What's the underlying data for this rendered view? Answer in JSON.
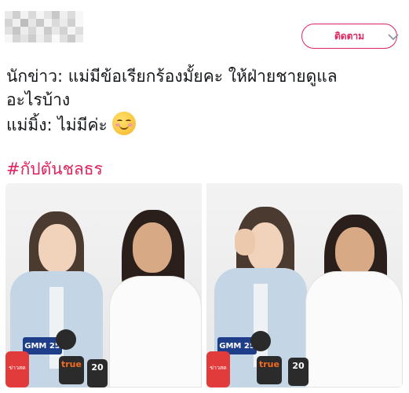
{
  "header": {
    "follow_label": "ติดตาม",
    "avatar_pixels": [
      "#e9e9e9",
      "#cfcfcf",
      "#f2f2f2",
      "#d9d9d9",
      "#f5f5f5",
      "#e4e4e4",
      "#c8c8c8",
      "#efefef",
      "#dcdcdc",
      "#f7f7f7",
      "#d4d4d4",
      "#f0f0f0",
      "#bdbdbd",
      "#e6e6e6",
      "#c9c9c9",
      "#f3f3f3",
      "#dadada",
      "#ebebeb",
      "#d0d0d0",
      "#f8f8f8",
      "#e1e1e1",
      "#c6c6c6",
      "#ededed",
      "#d7d7d7",
      "#f1f1f1",
      "#cbcbcb",
      "#e8e8e8",
      "#d2d2d2",
      "#f4f4f4",
      "#dedede",
      "#f6f6f6",
      "#d5d5d5",
      "#e3e3e3",
      "#cdcdcd",
      "#eeeeee",
      "#d8d8d8",
      "#f9f9f9",
      "#e0e0e0",
      "#cacaca",
      "#ececec"
    ]
  },
  "tweet": {
    "line1": "นักข่าว: แม่มีข้อเรียกร้องมั้ยคะ ให้ฝ่ายชายดูแล",
    "line2": "อะไรบ้าง",
    "line3": "แม่มิ้ง:  ไม่มีค่ะ",
    "emoji": "smiling-face-with-smiling-eyes",
    "hashtag": "#กัปตันชลธร"
  },
  "media": {
    "photo1": {
      "board_label": "GMM 25",
      "mic_brand": "true",
      "mic_channel": "20",
      "mic_red_label": "ข่าวสด"
    },
    "photo2": {
      "board_label": "GMM 25",
      "mic_brand": "true",
      "mic_channel": "20",
      "mic_red_label": "ข่าวสด"
    }
  },
  "colors": {
    "accent": "#e0245e",
    "text": "#14171a",
    "border": "#e1e8ed"
  }
}
